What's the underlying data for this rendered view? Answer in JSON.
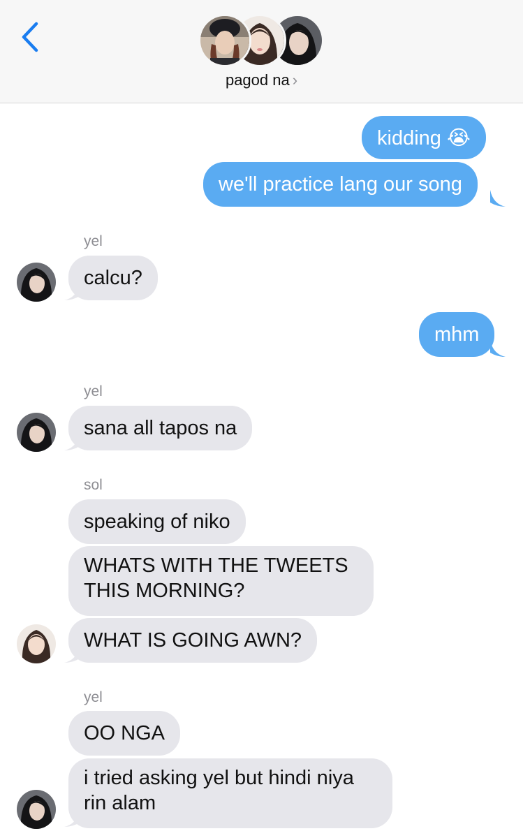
{
  "header": {
    "group_name": "pagod na",
    "chevron": "›",
    "back_icon": "chevron-left-icon",
    "member_avatars": [
      "member-avatar-1",
      "member-avatar-2",
      "member-avatar-3"
    ]
  },
  "messages": [
    {
      "direction": "out",
      "text": "kidding 😭"
    },
    {
      "direction": "out",
      "text": "we'll practice lang our song"
    },
    {
      "direction": "in",
      "sender": "yel",
      "text": "calcu?"
    },
    {
      "direction": "out",
      "text": "mhm"
    },
    {
      "direction": "in",
      "sender": "yel",
      "text": "sana all tapos na"
    },
    {
      "direction": "in",
      "sender": "sol",
      "text": "speaking of niko"
    },
    {
      "direction": "in",
      "text": "WHATS WITH THE TWEETS THIS MORNING?"
    },
    {
      "direction": "in",
      "text": "WHAT IS GOING AWN?"
    },
    {
      "direction": "in",
      "sender": "yel",
      "text": "OO NGA"
    },
    {
      "direction": "in",
      "text": "i tried asking yel but hindi niya rin alam"
    }
  ],
  "colors": {
    "outgoing_bubble": "#5aabf2",
    "incoming_bubble": "#e6e6eb",
    "accent_blue": "#1a7df0",
    "sender_label": "#8e8e93"
  }
}
